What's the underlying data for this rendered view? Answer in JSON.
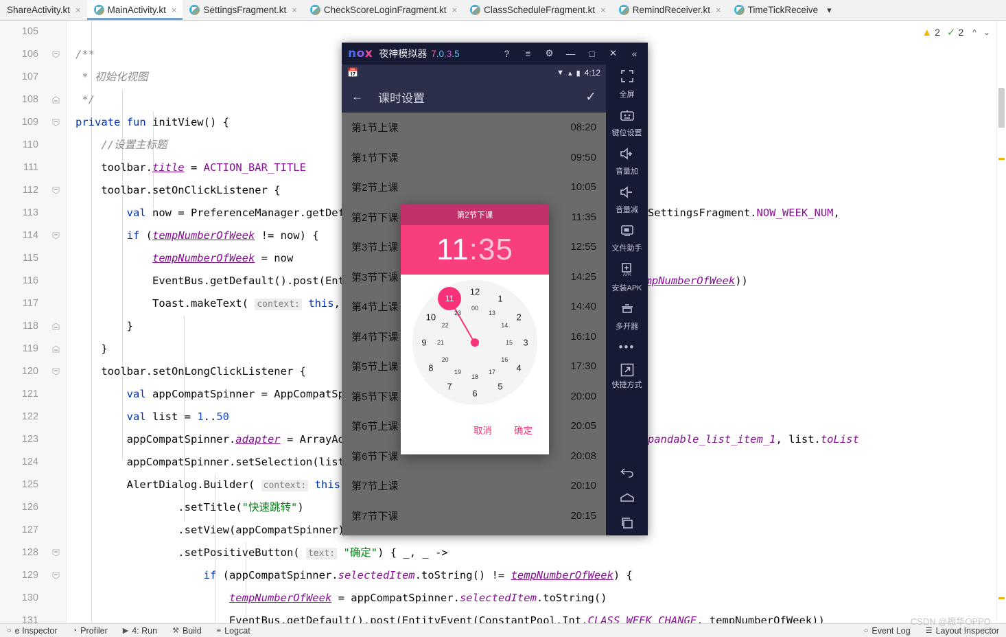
{
  "ide": {
    "tabs": [
      {
        "label": "ShareActivity.kt",
        "active": false,
        "icon": "kotlin-file-icon",
        "closable": true
      },
      {
        "label": "MainActivity.kt",
        "active": true,
        "icon": "kotlin-file-icon",
        "closable": true
      },
      {
        "label": "SettingsFragment.kt",
        "active": false,
        "icon": "kotlin-file-icon",
        "closable": true
      },
      {
        "label": "CheckScoreLoginFragment.kt",
        "active": false,
        "icon": "kotlin-file-icon",
        "closable": true
      },
      {
        "label": "ClassScheduleFragment.kt",
        "active": false,
        "icon": "kotlin-file-icon",
        "closable": true
      },
      {
        "label": "RemindReceiver.kt",
        "active": false,
        "icon": "kotlin-file-icon",
        "closable": true
      },
      {
        "label": "TimeTickReceive",
        "active": false,
        "icon": "kotlin-file-icon",
        "closable": false
      }
    ],
    "tab_overflow_icon": "chevron-down-icon",
    "inspection": {
      "warning_icon": "warning-triangle-icon",
      "warning_count": "2",
      "ok_icon": "inspection-check-icon",
      "ok_count": "2",
      "prev_icon": "chevron-up-icon",
      "next_icon": "chevron-down-icon"
    },
    "code_lines": [
      {
        "num": "105",
        "fold": "",
        "html": ""
      },
      {
        "num": "106",
        "fold": "minus",
        "html": "<span class=\"cmt\">/**</span>"
      },
      {
        "num": "107",
        "fold": "",
        "html": "<span class=\"cmt\"> * 初始化视图</span>"
      },
      {
        "num": "108",
        "fold": "end",
        "html": "<span class=\"cmt\"> */</span>"
      },
      {
        "num": "109",
        "fold": "minus",
        "html": "<span class=\"kw\">private fun</span> initView() {"
      },
      {
        "num": "110",
        "fold": "",
        "html": "    <span class=\"cmt\">//设置主标题</span>"
      },
      {
        "num": "111",
        "fold": "",
        "html": "    toolbar.<span class=\"fld\">title</span> = <span class=\"cst\">ACTION_BAR_TITLE</span>"
      },
      {
        "num": "112",
        "fold": "minus",
        "html": "    toolbar.setOnClickListener {"
      },
      {
        "num": "113",
        "fold": "",
        "html": "        <span class=\"kw\">val</span> now = PreferenceManager.getDefaultSharedPreferences( <span class=\"hint\">context:</span> <span class=\"kw\">this</span>).getString(SettingsFragment.<span class=\"cst\">NOW_WEEK_NUM</span>,"
      },
      {
        "num": "114",
        "fold": "minus",
        "html": "        <span class=\"kw\">if</span> (<span class=\"fld\">tempNumberOfWeek</span> != now) {"
      },
      {
        "num": "115",
        "fold": "",
        "html": "            <span class=\"fld\">tempNumberOfWeek</span> = now"
      },
      {
        "num": "116",
        "fold": "",
        "html": "            EventBus.getDefault().post(EntityEvent(ConstantPool.Int.<span class=\"csti\">CLASS_WEEK_CHANGE</span>, <span class=\"fld\">tempNumberOfWeek</span>))"
      },
      {
        "num": "117",
        "fold": "",
        "html": "            Toast.makeText( <span class=\"hint\">context:</span> <span class=\"kw\">this</span>, <span class=\"str\">\"已刷新\"</span>, Toast.<span class=\"csti\">LENGTH_SHORT</span>).show()"
      },
      {
        "num": "118",
        "fold": "end",
        "html": "        }"
      },
      {
        "num": "119",
        "fold": "end",
        "html": "    }"
      },
      {
        "num": "120",
        "fold": "minus",
        "html": "    toolbar.setOnLongClickListener {"
      },
      {
        "num": "121",
        "fold": "",
        "html": "        <span class=\"kw\">val</span> appCompatSpinner = AppCompatSpinner( <span class=\"hint\">context:</span> <span class=\"kw\">this</span>)"
      },
      {
        "num": "122",
        "fold": "",
        "html": "        <span class=\"kw\">val</span> list = <span class=\"num\">1</span>..<span class=\"num\">50</span>"
      },
      {
        "num": "123",
        "fold": "",
        "html": "        appCompatSpinner.<span class=\"fld\">adapter</span> = ArrayAdapter( <span class=\"hint\">context:</span> <span class=\"kw\">this</span>, android.R.layout.<span class=\"csti\">simple_expandable_list_item_1</span>, list.<span class=\"csti\">toList</span>"
      },
      {
        "num": "124",
        "fold": "",
        "html": "        appCompatSpinner.setSelection(list.indexOf(<span class=\"fld\">tempNumberOfWeek</span>.toInt()))"
      },
      {
        "num": "125",
        "fold": "",
        "html": "        AlertDialog.Builder( <span class=\"hint\">context:</span> <span class=\"kw\">this</span>)"
      },
      {
        "num": "126",
        "fold": "",
        "html": "                .setTitle(<span class=\"str\">\"快速跳转\"</span>)"
      },
      {
        "num": "127",
        "fold": "",
        "html": "                .setView(appCompatSpinner)"
      },
      {
        "num": "128",
        "fold": "minus",
        "html": "                .setPositiveButton( <span class=\"hint\">text:</span> <span class=\"str\">\"确定\"</span>) { _, _ -&gt;"
      },
      {
        "num": "129",
        "fold": "minus",
        "html": "                    <span class=\"kw\">if</span> (appCompatSpinner.<span class=\"csti\">selectedItem</span>.toString() != <span class=\"fld\">tempNumberOfWeek</span>) {"
      },
      {
        "num": "130",
        "fold": "",
        "html": "                        <span class=\"fld\">tempNumberOfWeek</span> = appCompatSpinner.<span class=\"csti\">selectedItem</span>.toString()"
      },
      {
        "num": "131",
        "fold": "",
        "html": "                        EventBus.getDefault().post(EntityEvent(ConstantPool.Int.<span class=\"csti\">CLASS_WEEK_CHANGE</span>, tempNumberOfWeek))"
      }
    ],
    "bottom_bar": {
      "items": [
        {
          "label": "e Inspector",
          "icon": "inspector-icon"
        },
        {
          "label": "Profiler",
          "icon": "profiler-icon"
        },
        {
          "label": "4: Run",
          "icon": "run-icon"
        },
        {
          "label": "Build",
          "icon": "build-hammer-icon"
        },
        {
          "label": "Logcat",
          "icon": "logcat-icon"
        }
      ],
      "right_items": [
        {
          "label": "Event Log",
          "icon": "event-log-icon"
        },
        {
          "label": "Layout Inspector",
          "icon": "layout-inspector-icon"
        }
      ]
    },
    "watermark": "CSDN @振华OPPO"
  },
  "emulator": {
    "logo": "nox-logo",
    "app_name": "夜神模拟器",
    "version": "7.0.3.5",
    "title_buttons": [
      {
        "name": "help-icon",
        "glyph": "?"
      },
      {
        "name": "menu-icon",
        "glyph": "≡"
      },
      {
        "name": "settings-gear-icon",
        "glyph": "⚙"
      },
      {
        "name": "minimize-icon",
        "glyph": "—"
      },
      {
        "name": "maximize-icon",
        "glyph": "□"
      },
      {
        "name": "close-icon",
        "glyph": "✕"
      },
      {
        "name": "collapse-rail-icon",
        "glyph": "«"
      }
    ],
    "android_status": {
      "left_icon": "calendar-app-icon",
      "wifi_icon": "wifi-icon",
      "signal_icon": "signal-icon",
      "battery_icon": "battery-icon",
      "time": "4:12"
    },
    "app_bar": {
      "back_icon": "back-arrow-icon",
      "title": "课时设置",
      "confirm_icon": "check-icon"
    },
    "list": [
      {
        "label": "第1节上课",
        "time": "08:20"
      },
      {
        "label": "第1节下课",
        "time": "09:50"
      },
      {
        "label": "第2节上课",
        "time": "10:05"
      },
      {
        "label": "第2节下课",
        "time": "11:35"
      },
      {
        "label": "第3节上课",
        "time": "12:55"
      },
      {
        "label": "第3节下课",
        "time": "14:25"
      },
      {
        "label": "第4节上课",
        "time": "14:40"
      },
      {
        "label": "第4节下课",
        "time": "16:10"
      },
      {
        "label": "第5节上课",
        "time": "17:30"
      },
      {
        "label": "第5节下课",
        "time": "20:00"
      },
      {
        "label": "第6节上课",
        "time": "20:05"
      },
      {
        "label": "第6节下课",
        "time": "20:08"
      },
      {
        "label": "第7节上课",
        "time": "20:10"
      },
      {
        "label": "第7节下课",
        "time": "20:15"
      }
    ],
    "dialog": {
      "title": "第2节下课",
      "hours": "11",
      "colon": ":",
      "minutes": "35",
      "selected_hour": "11",
      "clock_outer": [
        "12",
        "1",
        "2",
        "3",
        "4",
        "5",
        "6",
        "7",
        "8",
        "9",
        "10",
        "11"
      ],
      "clock_inner": [
        "00",
        "13",
        "14",
        "15",
        "16",
        "17",
        "18",
        "19",
        "20",
        "21",
        "22",
        "23"
      ],
      "cancel_label": "取消",
      "confirm_label": "确定",
      "accent_color": "#f9317a",
      "header_color": "#c2316b"
    },
    "rail": [
      {
        "label": "全屏",
        "icon": "fullscreen-icon"
      },
      {
        "label": "键位设置",
        "icon": "keymap-icon"
      },
      {
        "label": "音量加",
        "icon": "volume-up-icon"
      },
      {
        "label": "音量减",
        "icon": "volume-down-icon"
      },
      {
        "label": "文件助手",
        "icon": "file-assistant-icon"
      },
      {
        "label": "安装APK",
        "icon": "install-apk-icon"
      },
      {
        "label": "多开器",
        "icon": "multi-instance-icon"
      }
    ],
    "rail_more_icon": "more-dots-icon",
    "rail_shortcut": {
      "label": "快捷方式",
      "icon": "shortcut-icon"
    },
    "nav": [
      {
        "name": "nav-back-icon"
      },
      {
        "name": "nav-home-icon"
      },
      {
        "name": "nav-recents-icon"
      }
    ]
  }
}
